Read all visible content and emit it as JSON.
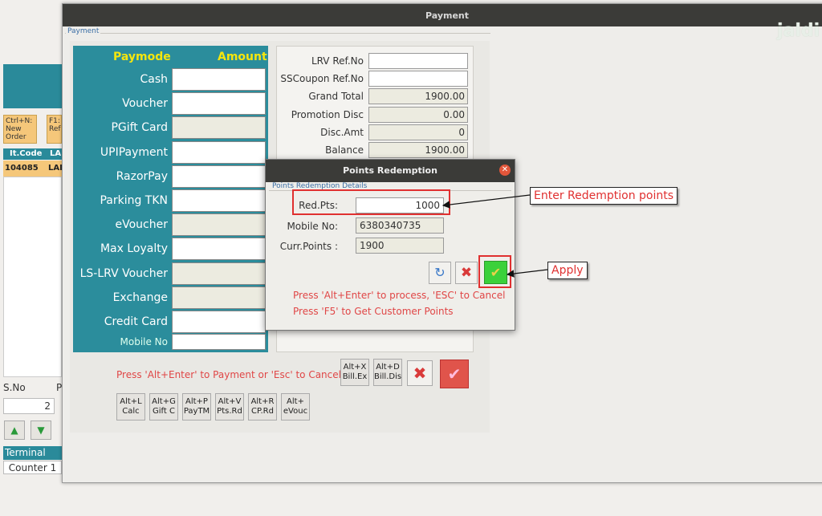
{
  "background_app": {
    "shortcuts": [
      {
        "label": "Ctrl+N:\nNew\nOrder"
      },
      {
        "label": "F1:\nRef"
      }
    ],
    "table_headers": [
      "It.Code",
      "LA"
    ],
    "row": {
      "code": "104085",
      "name": "LAI"
    },
    "sno_label": "S.No",
    "p_label": "P",
    "sno_value": "2",
    "terminal_label": "Terminal",
    "counter_value": "Counter 1"
  },
  "watermark": "jaldi",
  "window": {
    "title": "Payment",
    "group_label": "Payment"
  },
  "paymodes": {
    "header_mode": "Paymode",
    "header_amount": "Amount",
    "rows": [
      {
        "label": "Cash",
        "enabled": true
      },
      {
        "label": "Voucher",
        "enabled": true
      },
      {
        "label": "PGift Card",
        "enabled": false
      },
      {
        "label": "UPIPayment",
        "enabled": true
      },
      {
        "label": "RazorPay",
        "enabled": true
      },
      {
        "label": "Parking TKN",
        "enabled": true
      },
      {
        "label": "eVoucher",
        "enabled": false
      },
      {
        "label": "Max Loyalty",
        "enabled": true
      },
      {
        "label": "LS-LRV Voucher",
        "enabled": false
      },
      {
        "label": "Exchange",
        "enabled": false
      },
      {
        "label": "Credit Card",
        "enabled": true
      }
    ],
    "mobile_label": "Mobile No"
  },
  "summary": {
    "rows": [
      {
        "label": "LRV Ref.No",
        "value": "",
        "editable": true
      },
      {
        "label": "SSCoupon Ref.No",
        "value": "",
        "editable": true
      },
      {
        "label": "Grand Total",
        "value": "1900.00",
        "editable": false
      },
      {
        "label": "Promotion Disc",
        "value": "0.00",
        "editable": false
      },
      {
        "label": "Disc.Amt",
        "value": "0",
        "editable": false
      },
      {
        "label": "Balance",
        "value": "1900.00",
        "editable": false
      }
    ]
  },
  "footer": {
    "hint": "Press 'Alt+Enter' to Payment or 'Esc' to Cancel",
    "bill_buttons": [
      {
        "label": "Alt+X\nBill.Ex"
      },
      {
        "label": "Alt+D\nBill.Dis"
      }
    ],
    "shortcut_buttons": [
      {
        "label": "Alt+L\nCalc"
      },
      {
        "label": "Alt+G\nGift C"
      },
      {
        "label": "Alt+P\nPayTM"
      },
      {
        "label": "Alt+V\nPts.Rd"
      },
      {
        "label": "Alt+R\nCP.Rd"
      },
      {
        "label": "Alt+\neVouc"
      }
    ]
  },
  "dialog": {
    "title": "Points Redemption",
    "group_label": "Points Redemption Details",
    "red_pts_label": "Red.Pts:",
    "red_pts_value": "1000",
    "mobile_label": "Mobile No:",
    "mobile_value": "6380340735",
    "curr_points_label": "Curr.Points :",
    "curr_points_value": "1900",
    "hint1": "Press 'Alt+Enter' to process, 'ESC' to Cancel",
    "hint2": "Press 'F5' to Get Customer Points"
  },
  "annotations": {
    "enter_points": "Enter Redemption points",
    "apply": "Apply"
  },
  "colors": {
    "teal": "#2b8d9c",
    "title_bar": "#3b3b38",
    "accent_red": "#e03030",
    "paymode_header": "#f5e60d"
  }
}
